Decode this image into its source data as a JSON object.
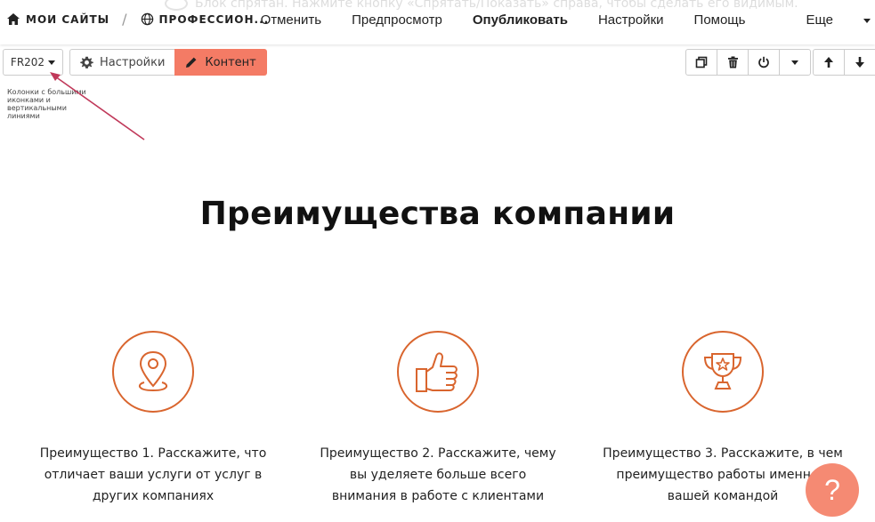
{
  "ghost_hint": "Блок спрятан. Нажмите кнопку «Спрятать/Показать» справа, чтобы сделать его видимым.",
  "brand": {
    "my_sites": "МОИ САЙТЫ",
    "site_name": "ПРОФЕССИОН..."
  },
  "nav": {
    "cancel": "Отменить",
    "preview": "Предпросмотр",
    "publish": "Опубликовать",
    "settings": "Настройки",
    "help": "Помощь",
    "more": "Еще"
  },
  "toolbar": {
    "block_code": "FR202",
    "settings_label": "Настройки",
    "content_label": "Контент",
    "hint": "Колонки с большими иконками и вертикальными линиями"
  },
  "page": {
    "heading": "Преимущества компании",
    "features": [
      {
        "icon": "map-pin-icon",
        "text": "Преимущество 1. Расскажите, что отличает ваши услуги от услуг в других компаниях"
      },
      {
        "icon": "thumbs-up-icon",
        "text": "Преимущество 2. Расскажите, чему вы уделяете больше всего внимания в работе с клиентами"
      },
      {
        "icon": "trophy-icon",
        "text": "Преимущество 3. Расскажите, в чем преимущество работы именно с вашей командой"
      }
    ]
  },
  "help_fab": "?",
  "colors": {
    "accent": "#f47b65",
    "icon_stroke": "#d9652e",
    "fab": "#f58a73",
    "arrow": "#c0395a"
  }
}
